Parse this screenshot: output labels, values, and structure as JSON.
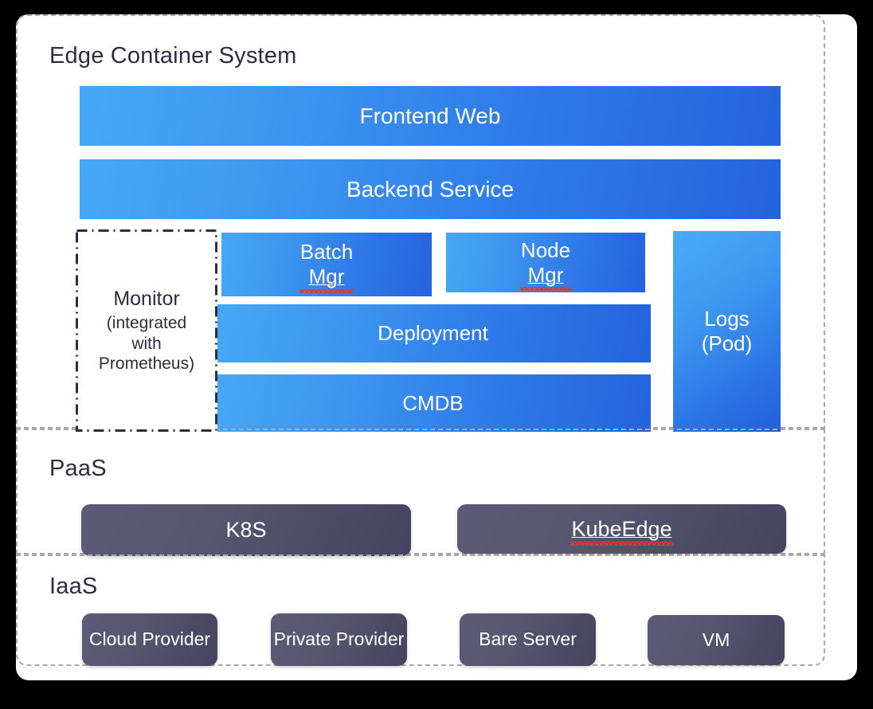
{
  "page": {
    "background_color": "#000000",
    "card_color": "#ffffff",
    "accent_blue_light": "#45a8f5",
    "accent_blue_dark": "#2463dd",
    "accent_purple_light": "#5b5b78",
    "accent_purple_dark": "#444460",
    "text_dark": "#2b2d42",
    "dashed_border_color": "#a9a9a9",
    "spellcheck_color": "#e8342a"
  },
  "sections": {
    "edge": {
      "title": "Edge Container System",
      "rows": {
        "frontend": "Frontend Web",
        "backend": "Backend Service",
        "batch_mgr_line1": "Batch",
        "batch_mgr_line2": "Mgr",
        "node_mgr_line1": "Node",
        "node_mgr_line2": "Mgr",
        "deployment": "Deployment",
        "cmdb": "CMDB",
        "logs_line1": "Logs",
        "logs_line2": "(Pod)"
      },
      "monitor": {
        "title": "Monitor",
        "subtitle": "(integrated with Prometheus)"
      }
    },
    "paas": {
      "title": "PaaS",
      "items": [
        {
          "label": "K8S",
          "spellcheck": false
        },
        {
          "label": "KubeEdge",
          "spellcheck": true
        }
      ]
    },
    "iaas": {
      "title": "IaaS",
      "items": [
        {
          "line1": "Cloud",
          "line2": "Provider"
        },
        {
          "line1": "Private",
          "line2": "Provider"
        },
        {
          "line1": "Bare",
          "line2": "Server"
        },
        {
          "line1": "VM",
          "line2": ""
        }
      ]
    }
  }
}
